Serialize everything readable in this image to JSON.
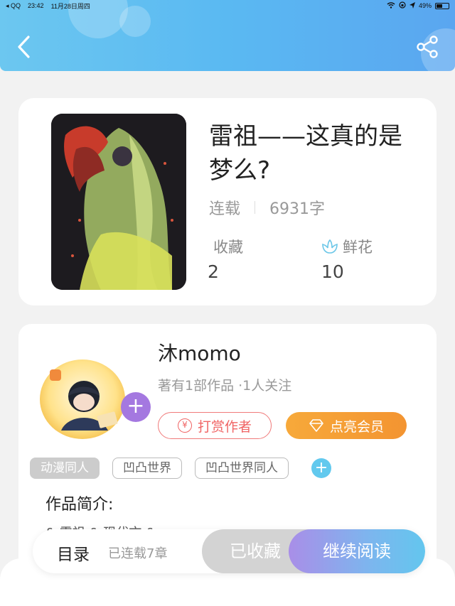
{
  "status_bar": {
    "app": "◂ QQ",
    "time": "23:42",
    "date": "11月28日周四",
    "battery": "49%"
  },
  "header": {
    "back_icon": "chevron-left-icon",
    "share_icon": "share-icon",
    "gradient": [
      "#6cc7f0",
      "#5aa6f0"
    ]
  },
  "book": {
    "title": "雷祖——这真的是梦么?",
    "status": "连载",
    "word_count": "6931字",
    "collect_label": "收藏",
    "collect_value": "2",
    "flower_label": "鲜花",
    "flower_value": "10"
  },
  "author": {
    "name": "沐momo",
    "subtitle": "著有1部作品 ·1人关注",
    "follow_symbol": "+",
    "reward_label": "打赏作者",
    "vip_label": "点亮会员"
  },
  "tags": [
    "动漫同人",
    "凹凸世界",
    "凹凸世界同人"
  ],
  "tag_add_symbol": "+",
  "intro": {
    "title": "作品简介:",
    "text": "& 雷祖 & 现代文 &"
  },
  "bottom_bar": {
    "toc_label": "目录",
    "toc_sub": "已连载7章",
    "collected_label": "已收藏",
    "read_label": "继续阅读"
  },
  "colors": {
    "reward": "#f06464",
    "vip": "#f39431",
    "accent_purple": "#a478e0",
    "tag_add": "#62c9ee"
  }
}
